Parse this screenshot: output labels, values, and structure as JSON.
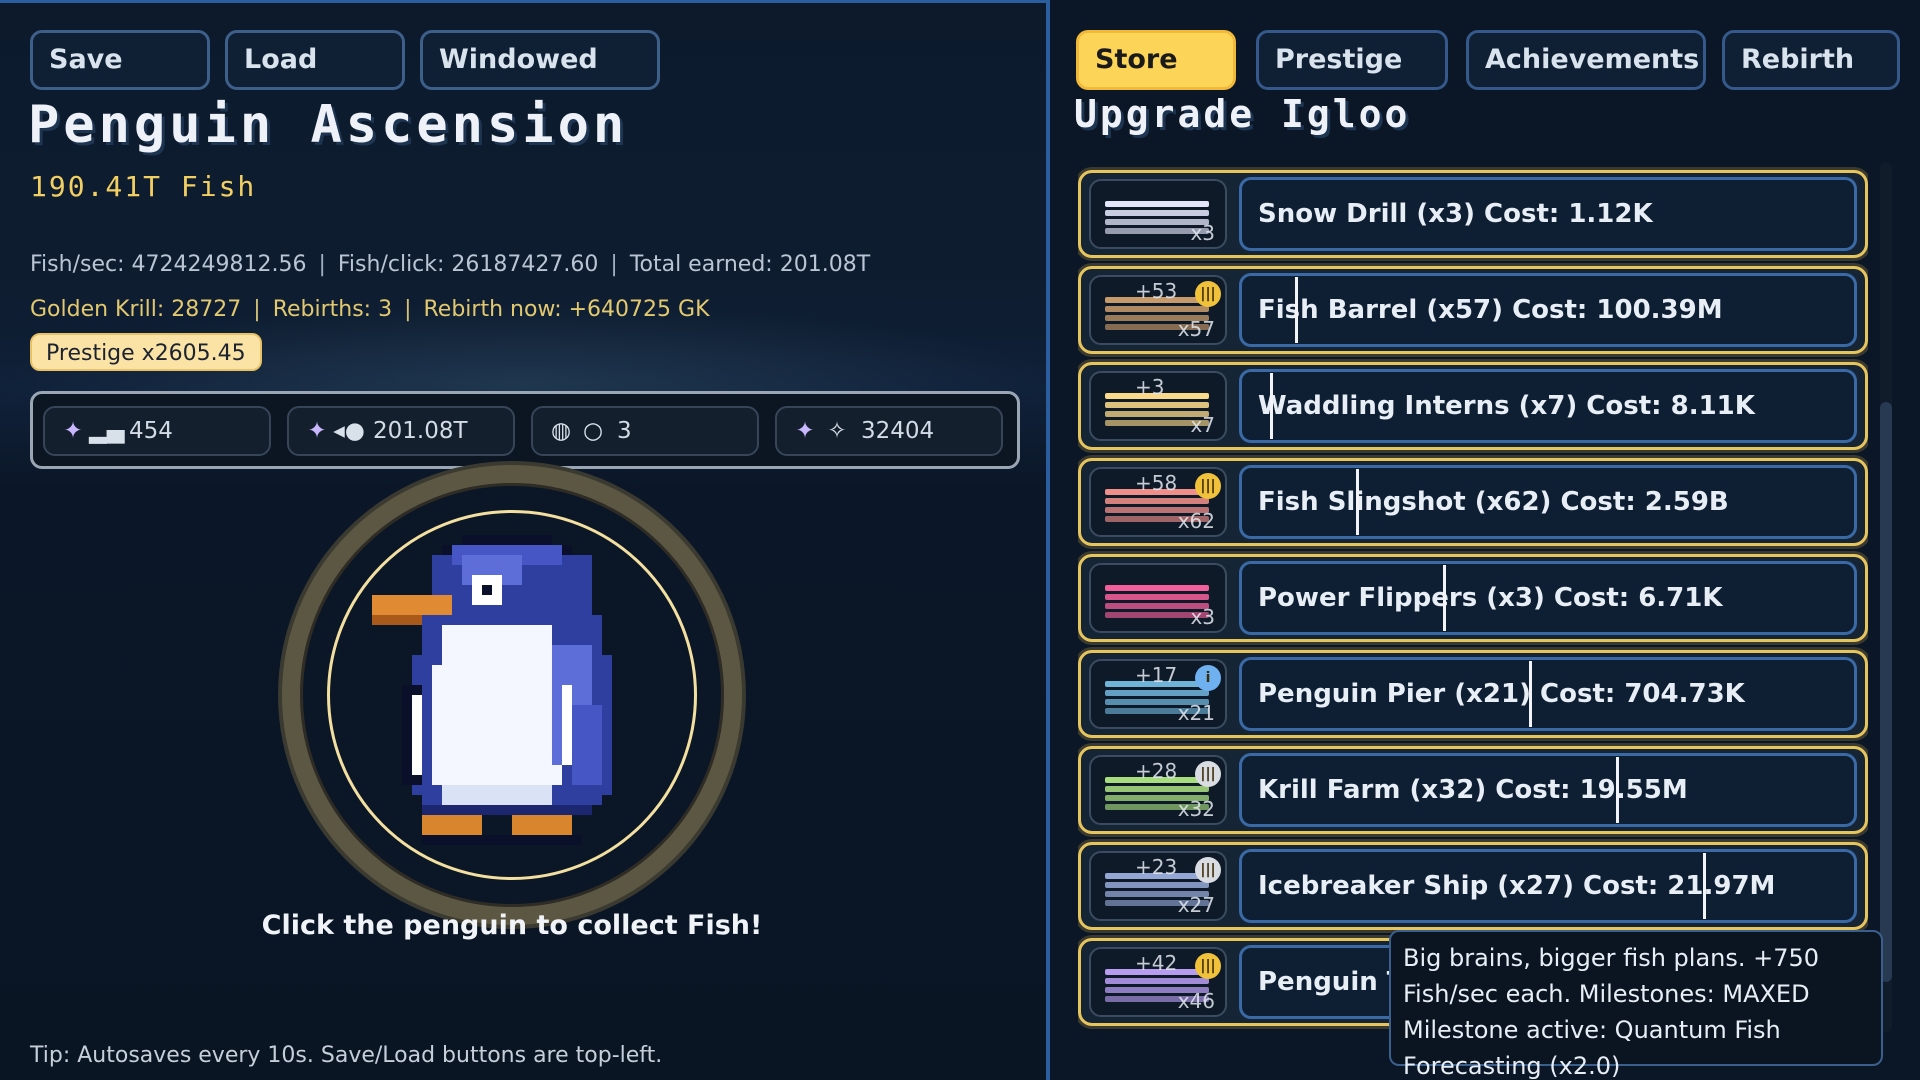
{
  "toolbar": {
    "save": "Save",
    "load": "Load",
    "windowed": "Windowed"
  },
  "game": {
    "title": "Penguin Ascension",
    "fish_total": "190.41T Fish",
    "fish_per_sec": "Fish/sec: 4724249812.56",
    "fish_per_click": "Fish/click: 26187427.60",
    "total_earned": "Total earned: 201.08T",
    "golden_krill": "Golden Krill: 28727",
    "rebirths": "Rebirths: 3",
    "rebirth_now": "Rebirth now: +640725 GK",
    "separator": "|",
    "prestige_multiplier": "Prestige x2605.45",
    "click_hint": "Click the penguin to collect Fish!",
    "tip": "Tip: Autosaves every 10s. Save/Load buttons are top-left."
  },
  "counters": [
    {
      "icon": "buildings-icon",
      "value": "454"
    },
    {
      "icon": "fish-icon",
      "value": "201.08T"
    },
    {
      "icon": "rebirth-icon",
      "value": "3"
    },
    {
      "icon": "sparkle-icon",
      "value": "32404"
    }
  ],
  "tabs": {
    "store": "Store",
    "prestige": "Prestige",
    "achievements": "Achievements",
    "rebirth": "Rebirth",
    "active": "Store"
  },
  "store": {
    "section_title": "Upgrade Igloo",
    "items": [
      {
        "label": "Snow Drill  (x3)  Cost: 1.12K",
        "owned": "x3",
        "plus": "",
        "color": "#e3e6fb",
        "badge": "",
        "progress": 0
      },
      {
        "label": "Fish Barrel  (x57)  Cost: 100.39M",
        "owned": "x57",
        "plus": "+53",
        "color": "#c69a6a",
        "badge": "gold",
        "progress": 0.09
      },
      {
        "label": "Waddling Interns  (x7)  Cost: 8.11K",
        "owned": "x7",
        "plus": "+3",
        "color": "#fbd98a",
        "badge": "",
        "progress": 0.05
      },
      {
        "label": "Fish Slingshot  (x62)  Cost: 2.59B",
        "owned": "x62",
        "plus": "+58",
        "color": "#f08f8a",
        "badge": "gold",
        "progress": 0.19
      },
      {
        "label": "Power Flippers  (x3)  Cost: 6.71K",
        "owned": "x3",
        "plus": "",
        "color": "#f25f9a",
        "badge": "",
        "progress": 0.33
      },
      {
        "label": "Penguin Pier  (x21)  Cost: 704.73K",
        "owned": "x21",
        "plus": "+17",
        "color": "#6fb3d8",
        "badge": "blue",
        "progress": 0.47
      },
      {
        "label": "Krill Farm  (x32)  Cost: 19.55M",
        "owned": "x32",
        "plus": "+28",
        "color": "#a8dd7f",
        "badge": "silver",
        "progress": 0.61
      },
      {
        "label": "Icebreaker Ship  (x27)  Cost: 21.97M",
        "owned": "x27",
        "plus": "+23",
        "color": "#93a6d4",
        "badge": "silver",
        "progress": 0.75
      },
      {
        "label": "Penguin T",
        "owned": "x46",
        "plus": "+42",
        "color": "#b79cf0",
        "badge": "gold",
        "progress": 0.0
      }
    ],
    "tooltip": "Big brains, bigger fish plans. +750 Fish/sec each. Milestones: MAXED Milestone active: Quantum Fish Forecasting (x2.0)"
  },
  "colors": {
    "accent": "#fcd458",
    "panel_border": "#2b5e9f",
    "gold_text": "#f2cf63"
  }
}
